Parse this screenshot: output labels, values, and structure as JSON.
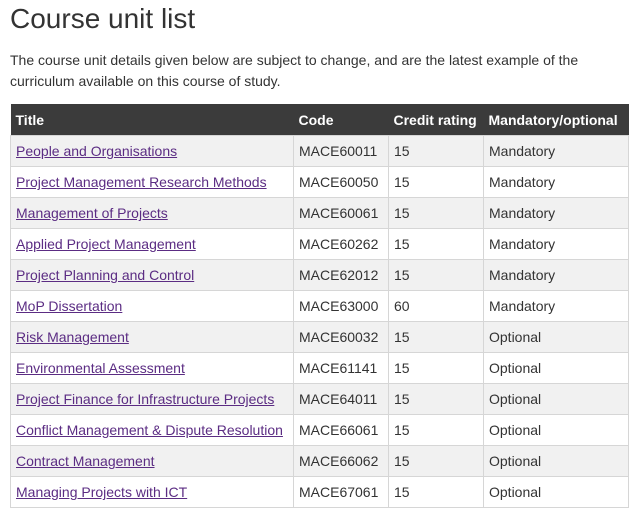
{
  "page": {
    "title": "Course unit list",
    "intro": "The course unit details given below are subject to change, and are the latest example of the curriculum available on this course of study."
  },
  "table": {
    "headers": {
      "title": "Title",
      "code": "Code",
      "credit": "Credit rating",
      "mandatory": "Mandatory/optional"
    },
    "rows": [
      {
        "title": "People and Organisations",
        "code": "MACE60011",
        "credit": "15",
        "status": "Mandatory"
      },
      {
        "title": "Project Management Research Methods",
        "code": "MACE60050",
        "credit": "15",
        "status": "Mandatory"
      },
      {
        "title": "Management of Projects",
        "code": "MACE60061",
        "credit": "15",
        "status": "Mandatory"
      },
      {
        "title": "Applied Project Management",
        "code": "MACE60262",
        "credit": "15",
        "status": "Mandatory"
      },
      {
        "title": "Project Planning and Control",
        "code": "MACE62012",
        "credit": "15",
        "status": "Mandatory"
      },
      {
        "title": "MoP Dissertation",
        "code": "MACE63000",
        "credit": "60",
        "status": "Mandatory"
      },
      {
        "title": "Risk Management",
        "code": "MACE60032",
        "credit": "15",
        "status": "Optional"
      },
      {
        "title": "Environmental Assessment",
        "code": "MACE61141",
        "credit": "15",
        "status": "Optional"
      },
      {
        "title": "Project Finance for Infrastructure Projects",
        "code": "MACE64011",
        "credit": "15",
        "status": "Optional"
      },
      {
        "title": "Conflict Management & Dispute Resolution",
        "code": "MACE66061",
        "credit": "15",
        "status": "Optional"
      },
      {
        "title": "Contract Management",
        "code": "MACE66062",
        "credit": "15",
        "status": "Optional"
      },
      {
        "title": "Managing Projects with ICT",
        "code": "MACE67061",
        "credit": "15",
        "status": "Optional"
      }
    ]
  },
  "colors": {
    "header_bg": "#3b3b3b",
    "link": "#5b2c83",
    "row_alt": "#f1f1f1"
  }
}
